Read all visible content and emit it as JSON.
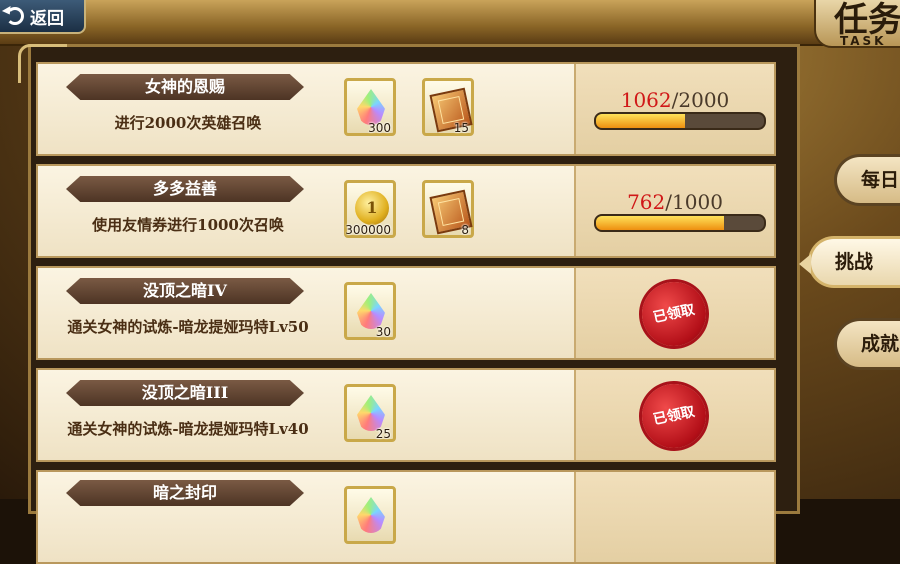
{
  "header": {
    "back_label": "返回",
    "title": "任务",
    "title_en": "TASK"
  },
  "side_tabs": [
    {
      "label": "每日",
      "active": false
    },
    {
      "label": "挑战",
      "active": true
    },
    {
      "label": "成就",
      "active": false
    }
  ],
  "quests": [
    {
      "title": "女神的恩赐",
      "desc": "进行2000次英雄召唤",
      "rewards": [
        {
          "icon": "rainbow-crystal-icon",
          "count": "300"
        },
        {
          "icon": "summon-ticket-icon",
          "count": "15"
        }
      ],
      "progress": {
        "current": "1062",
        "total": "2000",
        "fraction": 0.531
      }
    },
    {
      "title": "多多益善",
      "desc": "使用友情券进行1000次召唤",
      "rewards": [
        {
          "icon": "gold-coin-icon",
          "count": "300000"
        },
        {
          "icon": "summon-ticket-icon",
          "count": "8"
        }
      ],
      "progress": {
        "current": "762",
        "total": "1000",
        "fraction": 0.762
      }
    },
    {
      "title": "没顶之暗IV",
      "desc": "通关女神的试炼-暗龙提娅玛特Lv50",
      "rewards": [
        {
          "icon": "rainbow-crystal-icon",
          "count": "30"
        }
      ],
      "status": "已领取"
    },
    {
      "title": "没顶之暗III",
      "desc": "通关女神的试炼-暗龙提娅玛特Lv40",
      "rewards": [
        {
          "icon": "rainbow-crystal-icon",
          "count": "25"
        }
      ],
      "status": "已领取"
    },
    {
      "title": "暗之封印",
      "desc": "",
      "rewards": [
        {
          "icon": "rainbow-crystal-icon",
          "count": ""
        }
      ]
    }
  ],
  "colors": {
    "progress_current": "#d01818",
    "bar_fill": "#f0a020",
    "seal": "#c0141c"
  }
}
